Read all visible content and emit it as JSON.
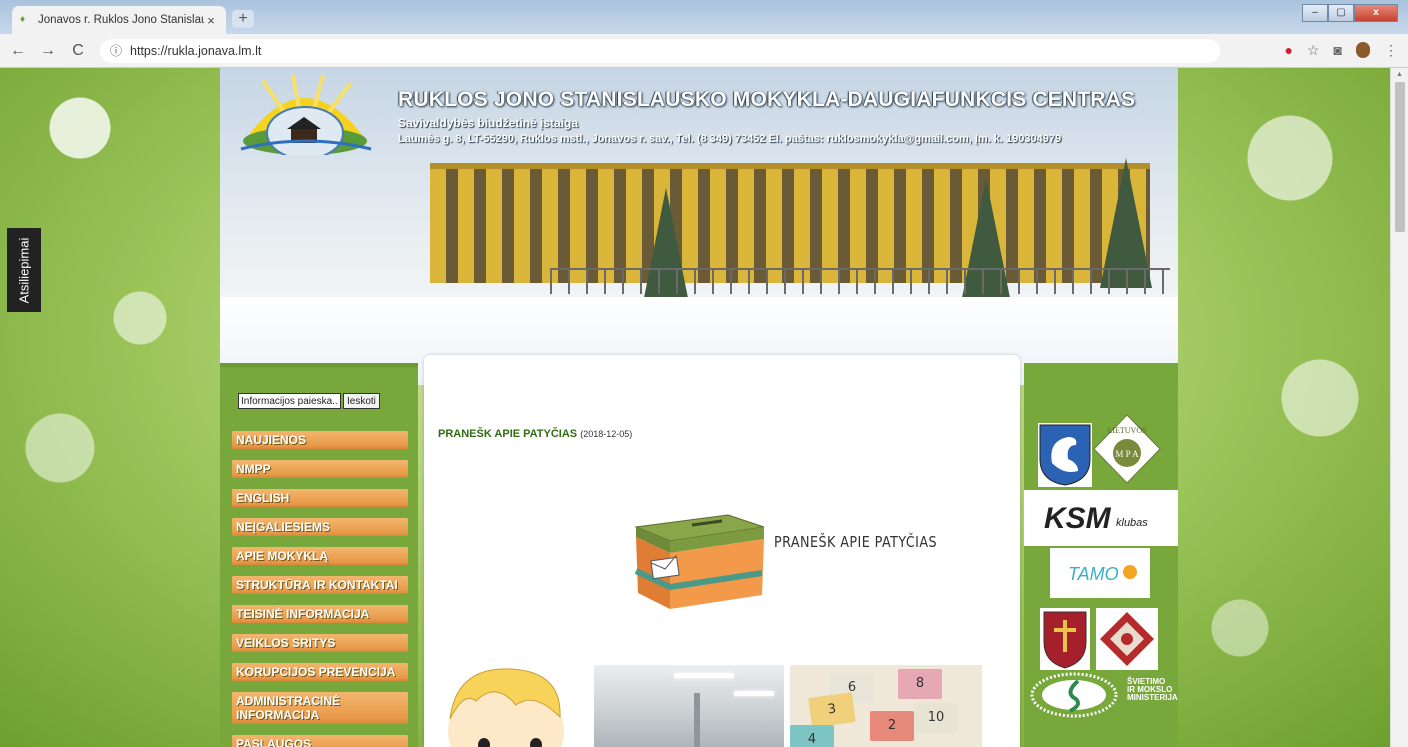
{
  "browser": {
    "tab_title": "Jonavos r. Ruklos Jono Stanislaus",
    "tab_close": "×",
    "new_tab": "+",
    "url": "https://rukla.jonava.lm.lt",
    "back": "←",
    "forward": "→",
    "reload": "C",
    "info": "ⓘ",
    "win_min": "–",
    "win_max": "▢",
    "win_close": "x",
    "star": "☆",
    "camera": "◙",
    "menu": "⋮"
  },
  "feedback": {
    "label": "Atsiliepimai"
  },
  "header": {
    "title": "RUKLOS JONO STANISLAUSKO MOKYKLA-DAUGIAFUNKCIS CENTRAS",
    "subtitle": "Savivaldybės biudžetinė įstaiga",
    "address": "Laumės g. 8, LT-55290, Ruklos mstl., Jonavos r. sav., Tel. (8 349) 73452 El. paštas: ruklosmokykla@gmail.com,  Įm. k. 190304979"
  },
  "search": {
    "value": "Informacijos paieska...",
    "button": "Ieskoti"
  },
  "menu": {
    "items": [
      {
        "label": "NAUJIENOS"
      },
      {
        "label": "NMPP"
      },
      {
        "label": "ENGLISH"
      },
      {
        "label": "NEĮGALIESIEMS"
      },
      {
        "label": "APIE MOKYKLĄ"
      },
      {
        "label": "STRUKTŪRA IR KONTAKTAI"
      },
      {
        "label": "TEISINĖ INFORMACIJA"
      },
      {
        "label": "VEIKLOS SRITYS"
      },
      {
        "label": "KORUPCIJOS PREVENCIJA"
      },
      {
        "label": "ADMINISTRACINĖ INFORMACIJA"
      },
      {
        "label": "PASLAUGOS"
      }
    ]
  },
  "post": {
    "title": "PRANEŠK APIE PATYČIAS",
    "date": "(2018-12-05)",
    "image_caption": "PRANEŠK APIE PATYČIAS"
  },
  "gallery": {
    "cards": [
      "6",
      "8",
      "3",
      "2",
      "10",
      "4"
    ]
  },
  "partners": {
    "lietuvos": "LIETUVOS",
    "mpa": "M P A",
    "ksm": "KSM",
    "klubas": "klubas",
    "tamo": "TAMO",
    "ministry_line1": "ŠVIETIMO",
    "ministry_line2": "IR MOKSLO",
    "ministry_line3": "MINISTERIJA"
  },
  "colors": {
    "menu_orange": "#e89a49",
    "sidebar_green": "#78a83c",
    "title_green": "#2f6d12"
  }
}
